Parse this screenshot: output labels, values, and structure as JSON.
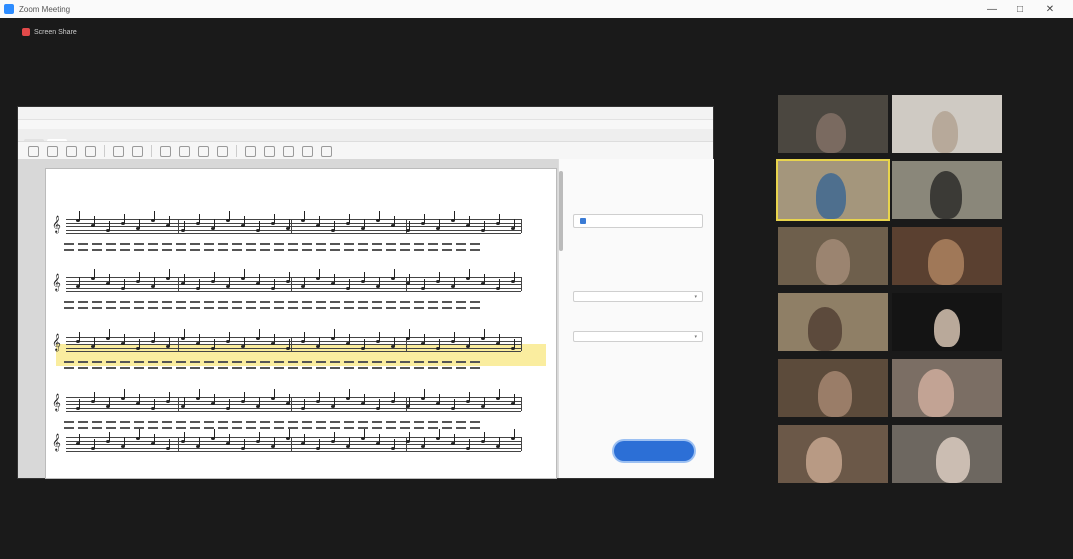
{
  "window": {
    "title": "Zoom Meeting",
    "minimize": "—",
    "maximize": "□",
    "close": "✕"
  },
  "share": {
    "indicator": "Screen Share"
  },
  "shared_app": {
    "titlebar": "",
    "menus": [
      "",
      "",
      "",
      "",
      "",
      "",
      ""
    ],
    "tabs": [
      "",
      ""
    ],
    "score": {
      "title": "",
      "credits": [
        "",
        "",
        ""
      ]
    },
    "panel": {
      "heading": "",
      "card": "",
      "label": "",
      "text": "",
      "select1": "",
      "select2": "",
      "note": "",
      "button": ""
    }
  },
  "participants": [
    {
      "name": ""
    },
    {
      "name": ""
    },
    {
      "name": ""
    },
    {
      "name": ""
    },
    {
      "name": ""
    },
    {
      "name": ""
    },
    {
      "name": ""
    },
    {
      "name": ""
    },
    {
      "name": ""
    },
    {
      "name": ""
    },
    {
      "name": ""
    },
    {
      "name": ""
    }
  ],
  "colors": {
    "accent": "#2d8cff",
    "highlight": "#f6de50",
    "active_speaker": "#e8d44d",
    "primary_button": "#2c6fd6"
  }
}
